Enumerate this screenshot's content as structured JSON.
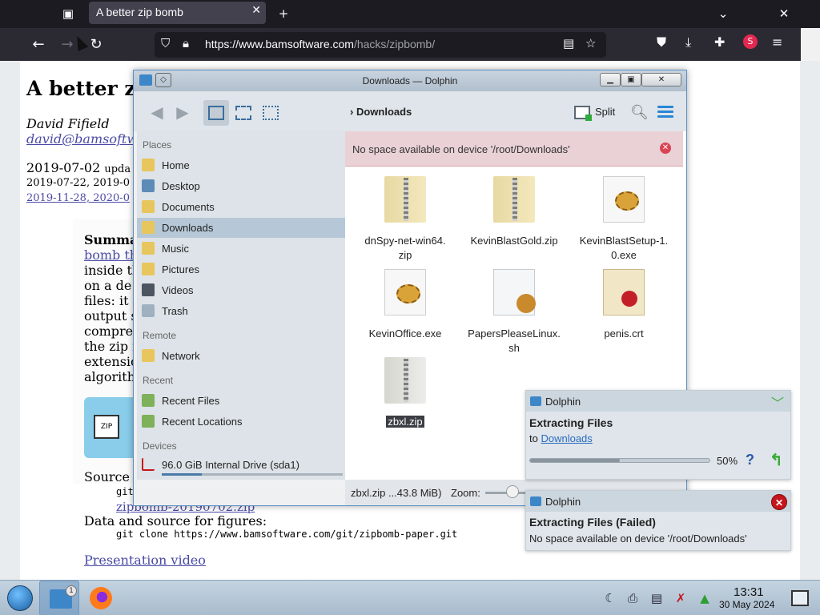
{
  "firefox": {
    "tab_title": "A better zip bomb",
    "url_host": "https://www.bamsoftware.com",
    "url_path": "/hacks/zipbomb/"
  },
  "webpage": {
    "title": "A better zip bomb",
    "author": "David Fifield",
    "email": "david@bamsoftw",
    "date_main": "2019-07-02",
    "date_small": "upda",
    "date_line2": "2019-07-22, 2019-0",
    "date_line3": "2019-11-28, 2020-0",
    "summary_lines": [
      "Summa",
      "bomb th",
      "inside th",
      "on a de",
      "files: it",
      "output s",
      "compres",
      "the zip f",
      "extensio",
      "algorith"
    ],
    "zip_icon_label": "ZIP",
    "source_label": "Source",
    "source_code": "git",
    "source_link": "zipbomb-20190702.zip",
    "data_source_label": "Data and source for figures:",
    "data_source_code": "git clone https://www.bamsoftware.com/git/zipbomb-paper.git",
    "video_link": "Presentation video"
  },
  "dolphin": {
    "window_title": "Downloads — Dolphin",
    "breadcrumb": "Downloads",
    "split_label": "Split",
    "error_message": "No space available on device '/root/Downloads'",
    "places": {
      "sections": {
        "places": "Places",
        "remote": "Remote",
        "recent": "Recent",
        "devices": "Devices"
      },
      "items": {
        "home": "Home",
        "desktop": "Desktop",
        "documents": "Documents",
        "downloads": "Downloads",
        "music": "Music",
        "pictures": "Pictures",
        "videos": "Videos",
        "trash": "Trash",
        "network": "Network",
        "recent_files": "Recent Files",
        "recent_locations": "Recent Locations",
        "drive": "96.0 GiB Internal Drive (sda1)"
      },
      "drive_used_fraction": 0.22
    },
    "files": [
      {
        "name_line1": "dnSpy-net-win64.",
        "name_line2": "zip",
        "type": "zip"
      },
      {
        "name_line1": "KevinBlastGold.zip",
        "name_line2": "",
        "type": "zip"
      },
      {
        "name_line1": "KevinBlastSetup-1.",
        "name_line2": "0.exe",
        "type": "exe"
      },
      {
        "name_line1": "KevinOffice.exe",
        "name_line2": "",
        "type": "exe"
      },
      {
        "name_line1": "PapersPleaseLinux.",
        "name_line2": "sh",
        "type": "sh"
      },
      {
        "name_line1": "penis.crt",
        "name_line2": "",
        "type": "crt"
      },
      {
        "name_line1": "zbxl.zip",
        "name_line2": "",
        "type": "zip",
        "selected": true
      }
    ],
    "status_text": "zbxl.zip ...43.8 MiB)",
    "zoom_label": "Zoom:"
  },
  "notifications": [
    {
      "app": "Dolphin",
      "title": "Extracting Files",
      "text_prefix": "to",
      "link": "Downloads",
      "progress_percent": 50,
      "progress_label": "50%"
    },
    {
      "app": "Dolphin",
      "title": "Extracting Files (Failed)",
      "text": "No space available on device '/root/Downloads'"
    }
  ],
  "taskbar": {
    "dolphin_badge": "1",
    "time": "13:31",
    "date": "30 May 2024"
  },
  "colors": {
    "accent": "#3d87c8",
    "error_bg": "#e9d1d5",
    "error_icon": "#da4453",
    "link": "#4a4aa6"
  }
}
